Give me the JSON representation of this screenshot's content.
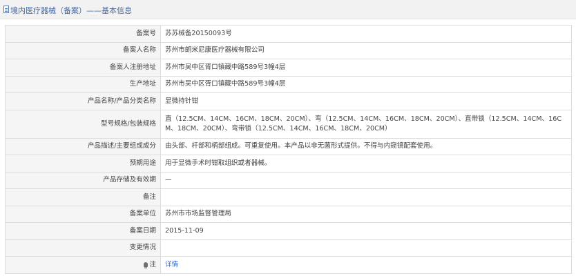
{
  "header": {
    "title": "境内医疗器械（备案）——基本信息",
    "icon": "document-icon"
  },
  "rows": [
    {
      "label": "备案号",
      "value": "苏苏械备20150093号"
    },
    {
      "label": "备案人名称",
      "value": "苏州市朗米尼康医疗器械有限公司"
    },
    {
      "label": "备案人注册地址",
      "value": "苏州市吴中区胥口镇藏中路589号3幢4层"
    },
    {
      "label": "生产地址",
      "value": "苏州市吴中区胥口镇藏中路589号3幢4层"
    },
    {
      "label": "产品名称/产品分类名称",
      "value": "显微持针钳"
    },
    {
      "label": "型号规格/包装规格",
      "value": "直（12.5CM、14CM、16CM、18CM、20CM）、弯（12.5CM、14CM、16CM、18CM、20CM）、直带锁（12.5CM、14CM、16CM、18CM、20CM）、弯带锁（12.5CM、14CM、16CM、18CM、20CM）"
    },
    {
      "label": "产品描述/主要组成成分",
      "value": "由头部、杆部和柄部组成。可重复使用。本产品以非无菌形式提供。不得与内窥镜配套使用。"
    },
    {
      "label": "预期用途",
      "value": "用于显微手术时钳取组织或者器械。"
    },
    {
      "label": "产品存储及有效期",
      "value": "—"
    },
    {
      "label": "备注",
      "value": ""
    },
    {
      "label": "备案单位",
      "value": "苏州市市场监督管理局"
    },
    {
      "label": "备案日期",
      "value": "2015-11-09"
    },
    {
      "label": "变更情况",
      "value": ""
    },
    {
      "label": "注",
      "value": "详情",
      "icon": "lightbulb-icon"
    }
  ]
}
